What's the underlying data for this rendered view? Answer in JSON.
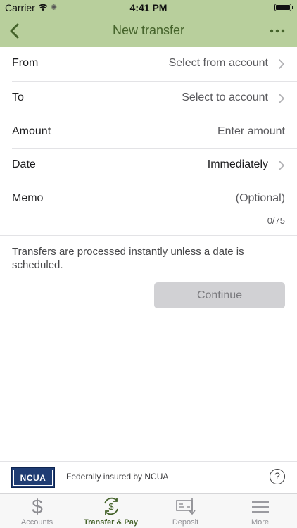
{
  "status_bar": {
    "carrier": "Carrier",
    "time": "4:41 PM"
  },
  "nav": {
    "title": "New transfer",
    "back_icon": "chevron-left-icon",
    "more_icon": "ellipsis-icon"
  },
  "form": {
    "from": {
      "label": "From",
      "value": "Select from account"
    },
    "to": {
      "label": "To",
      "value": "Select to account"
    },
    "amount": {
      "label": "Amount",
      "placeholder": "Enter amount"
    },
    "date": {
      "label": "Date",
      "value": "Immediately"
    },
    "memo": {
      "label": "Memo",
      "placeholder": "(Optional)",
      "counter": "0/75"
    }
  },
  "note": "Transfers are processed instantly unless a date is scheduled.",
  "continue_label": "Continue",
  "insurance": {
    "logo_text": "NCUA",
    "text": "Federally insured by NCUA",
    "help_label": "?"
  },
  "tabs": [
    {
      "label": "Accounts",
      "icon": "dollar-icon",
      "active": false
    },
    {
      "label": "Transfer & Pay",
      "icon": "transfer-pay-icon",
      "active": true
    },
    {
      "label": "Deposit",
      "icon": "check-deposit-icon",
      "active": false
    },
    {
      "label": "More",
      "icon": "menu-icon",
      "active": false
    }
  ],
  "colors": {
    "header_bg": "#b8cf9c",
    "accent": "#44622a",
    "button_disabled": "#d1d1d4"
  }
}
